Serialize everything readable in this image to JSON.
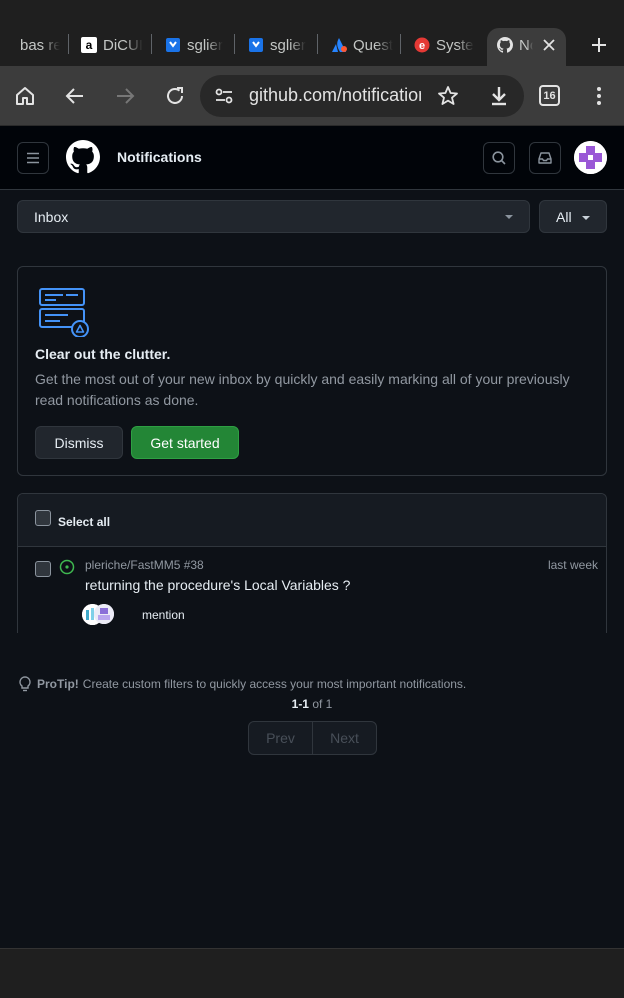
{
  "browser": {
    "tabs": [
      {
        "title": "bas re",
        "icon": "generic-page-icon"
      },
      {
        "title": "DiCUI",
        "icon": "amazon-icon"
      },
      {
        "title": "sglier",
        "icon": "favicon-blue-icon"
      },
      {
        "title": "sglier",
        "icon": "favicon-blue-icon"
      },
      {
        "title": "Quest",
        "icon": "atlassian-icon"
      },
      {
        "title": "Syste",
        "icon": "favicon-red-icon"
      },
      {
        "title": "Notifications",
        "icon": "github-icon"
      }
    ],
    "url": "github.com/notifications",
    "tab_count": "16"
  },
  "header": {
    "title": "Notifications"
  },
  "filters": {
    "inbox_label": "Inbox",
    "all_label": "All"
  },
  "clutter_card": {
    "title": "Clear out the clutter.",
    "body": "Get the most out of your new inbox by quickly and easily marking all of your previously read notifications as done.",
    "dismiss_label": "Dismiss",
    "get_started_label": "Get started"
  },
  "list": {
    "select_all_label": "Select all",
    "notifications": [
      {
        "repo": "pleriche/FastMM5 #38",
        "subject": "returning the procedure's Local Variables ?",
        "time": "last week",
        "reason": "mention",
        "state_color": "#3fb950"
      }
    ]
  },
  "footer": {
    "protip_bold": "ProTip!",
    "protip_text": "Create custom filters to quickly access your most important notifications.",
    "page_range": "1-1",
    "page_of": "of 1",
    "prev_label": "Prev",
    "next_label": "Next"
  },
  "colors": {
    "accent_green": "#238636",
    "background": "#0d1117",
    "border": "#30363d"
  }
}
